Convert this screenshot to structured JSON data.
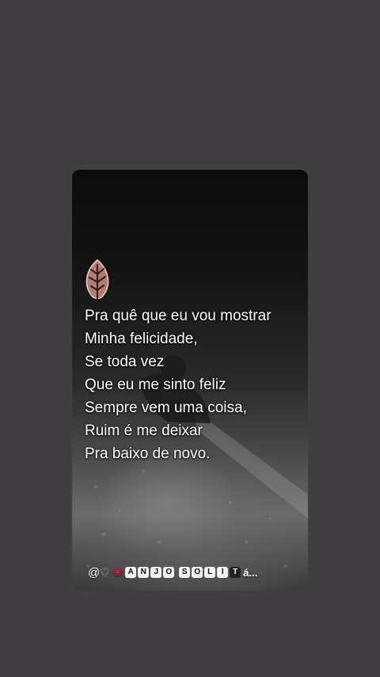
{
  "lyrics": [
    "Pra quê que eu vou mostrar",
    "Minha felicidade,",
    "Se toda vez",
    "Que eu me sinto feliz",
    "Sempre vem uma coisa,",
    "Ruim é me deixar",
    "Pra baixo de novo."
  ],
  "footer": {
    "at": "@",
    "word1": [
      "A",
      "N",
      "J",
      "O"
    ],
    "word2": [
      "S",
      "O",
      "L",
      "I",
      "T"
    ],
    "tail": "á..."
  },
  "icons": {
    "leaf": "leaf-icon",
    "heart": "heart-icon",
    "rose": "rose-icon"
  }
}
